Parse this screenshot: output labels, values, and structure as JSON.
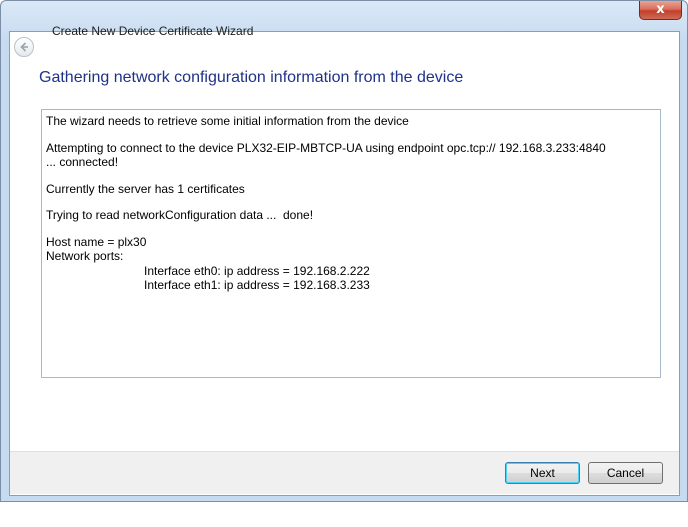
{
  "window": {
    "close_symbol": "x"
  },
  "header": {
    "wizard_title": "Create New Device Certificate Wizard",
    "back_icon": "back-arrow-icon"
  },
  "page": {
    "heading": "Gathering network configuration information from the device"
  },
  "log": {
    "line1": "The wizard needs to retrieve some initial information from the device",
    "line2": "Attempting to connect to the device PLX32-EIP-MBTCP-UA using endpoint opc.tcp:// 192.168.3.233:4840 ... connected!",
    "line3": "Currently the server has 1 certificates",
    "line4": "Trying to read networkConfiguration data ...  done!",
    "line5": "Host name = plx30",
    "line6": "Network ports:",
    "line7": "Interface eth0: ip address = 192.168.2.222",
    "line8": "Interface eth1: ip address = 192.168.3.233"
  },
  "footer": {
    "next_label": "Next",
    "cancel_label": "Cancel"
  },
  "colors": {
    "heading": "#1e3287",
    "close_button": "#c2402a"
  }
}
